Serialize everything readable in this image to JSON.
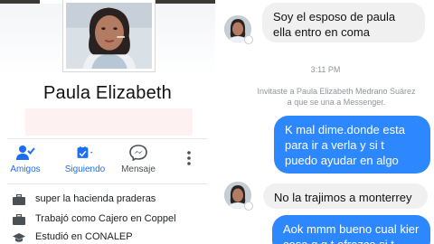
{
  "profile": {
    "name": "Paula Elizabeth",
    "actions": [
      {
        "label": "Amigos",
        "icon": "person-check-icon"
      },
      {
        "label": "Siguiendo",
        "icon": "following-feed-icon"
      },
      {
        "label": "Mensaje",
        "icon": "messenger-icon"
      }
    ],
    "more_icon": "more-vertical-icon",
    "info": [
      {
        "icon": "briefcase-icon",
        "text": "super la hacienda praderas"
      },
      {
        "icon": "briefcase-icon",
        "text": "Trabajó como Cajero en Coppel"
      },
      {
        "icon": "graduation-cap-icon",
        "text": "Estudió en CONALEP"
      }
    ],
    "colors": {
      "accent": "#1d6ef5",
      "text": "#1c1e21",
      "muted": "#4b4f56"
    }
  },
  "messenger": {
    "messages": [
      {
        "from": "contact",
        "text": "Soy el esposo de paula ella entro en coma"
      },
      {
        "from": "me",
        "text": "K mal dime.donde esta para ir a verla y si t puedo ayudar en algo"
      },
      {
        "from": "contact",
        "text": "No la trajimos a monterrey"
      },
      {
        "from": "me",
        "text": "Aok mmm bueno cual kier cosa q q t ofrezca si t"
      }
    ],
    "timestamp": "3:11 PM",
    "system_message": "Invitaste a Paula Elizabeth Medrano Suárez a que se una a Messenger.",
    "colors": {
      "outgoing": "#2d88ff",
      "incoming": "#f1f0f0",
      "meta": "#90949c"
    }
  }
}
